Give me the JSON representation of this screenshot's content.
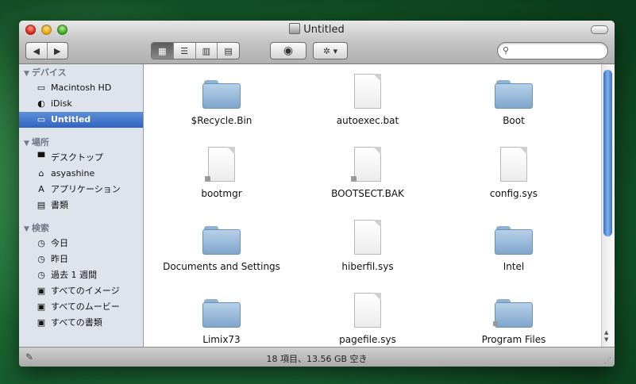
{
  "window": {
    "title": "Untitled"
  },
  "toolbar": {
    "back_icon": "◀",
    "forward_icon": "▶",
    "view_icons": [
      "▦",
      "☰",
      "▥",
      "▤"
    ],
    "eye_icon": "◉",
    "gear_icon": "✲ ▾",
    "search": {
      "value": "",
      "placeholder": ""
    }
  },
  "sidebar": {
    "sections": [
      {
        "title": "デバイス",
        "items": [
          {
            "label": "Macintosh HD",
            "icon": "▭"
          },
          {
            "label": "iDisk",
            "icon": "◐"
          },
          {
            "label": "Untitled",
            "icon": "▭",
            "selected": true
          }
        ]
      },
      {
        "title": "場所",
        "items": [
          {
            "label": "デスクトップ",
            "icon": "▀"
          },
          {
            "label": "asyashine",
            "icon": "⌂"
          },
          {
            "label": "アプリケーション",
            "icon": "A"
          },
          {
            "label": "書類",
            "icon": "▤"
          }
        ]
      },
      {
        "title": "検索",
        "items": [
          {
            "label": "今日",
            "icon": "◷"
          },
          {
            "label": "昨日",
            "icon": "◷"
          },
          {
            "label": "過去 1 週間",
            "icon": "◷"
          },
          {
            "label": "すべてのイメージ",
            "icon": "▣"
          },
          {
            "label": "すべてのムービー",
            "icon": "▣"
          },
          {
            "label": "すべての書類",
            "icon": "▣"
          }
        ]
      }
    ]
  },
  "files": [
    {
      "name": "$Recycle.Bin",
      "kind": "folder"
    },
    {
      "name": "autoexec.bat",
      "kind": "document"
    },
    {
      "name": "Boot",
      "kind": "folder"
    },
    {
      "name": "bootmgr",
      "kind": "document",
      "locked": true
    },
    {
      "name": "BOOTSECT.BAK",
      "kind": "document",
      "locked": true
    },
    {
      "name": "config.sys",
      "kind": "document"
    },
    {
      "name": "Documents and Settings",
      "kind": "folder"
    },
    {
      "name": "hiberfil.sys",
      "kind": "document"
    },
    {
      "name": "Intel",
      "kind": "folder"
    },
    {
      "name": "Limix73",
      "kind": "folder"
    },
    {
      "name": "pagefile.sys",
      "kind": "document"
    },
    {
      "name": "Program Files",
      "kind": "folder",
      "locked": true
    }
  ],
  "status": {
    "text": "18 項目、13.56 GB 空き"
  },
  "colors": {
    "selection": "#3a6fc8",
    "sidebar_bg": "#dfe4ec",
    "folder": "#8fb2d4"
  }
}
